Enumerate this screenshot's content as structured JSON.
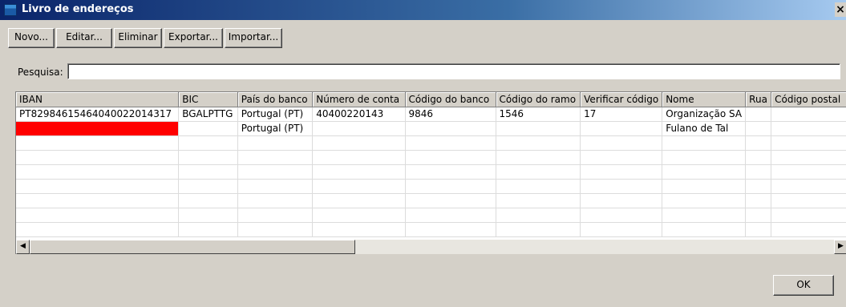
{
  "window": {
    "title": "Livro de endereços",
    "close_glyph": "×"
  },
  "toolbar": {
    "buttons": [
      {
        "label": "Novo..."
      },
      {
        "label": "Editar..."
      },
      {
        "label": "Eliminar"
      },
      {
        "label": "Exportar..."
      },
      {
        "label": "Importar..."
      }
    ]
  },
  "search": {
    "label": "Pesquisa:",
    "value": "",
    "placeholder": ""
  },
  "table": {
    "columns": [
      "IBAN",
      "BIC",
      "País do banco",
      "Número de conta",
      "Código do banco",
      "Código do ramo",
      "Verificar código",
      "Nome",
      "Rua",
      "Código postal"
    ],
    "rows": [
      [
        "PT82984615464040022014317",
        "BGALPTTG",
        "Portugal (PT)",
        "40400220143",
        "9846",
        "1546",
        "17",
        "Organização SA",
        "",
        ""
      ],
      [
        "",
        "",
        "Portugal (PT)",
        "",
        "",
        "",
        "",
        "Fulano de Tal",
        "",
        ""
      ]
    ],
    "invalid_color": "#ff0000"
  },
  "scrollbar": {
    "left_icon": "◀",
    "right_icon": "▶"
  },
  "footer": {
    "ok_label": "OK"
  }
}
